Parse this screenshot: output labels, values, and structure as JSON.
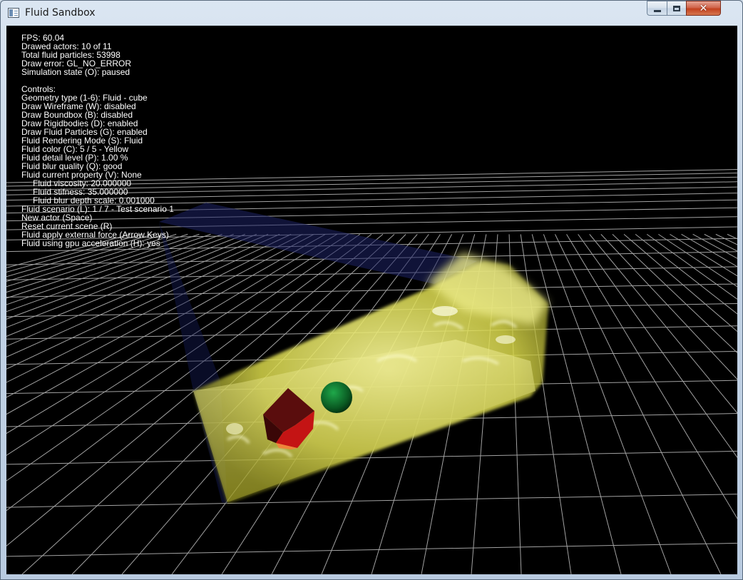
{
  "window": {
    "title": "Fluid Sandbox",
    "buttons": {
      "minimize": "minimize-icon",
      "maximize": "maximize-icon",
      "close": "close-icon"
    }
  },
  "hud": {
    "status": [
      "FPS: 60.04",
      "Drawed actors: 10 of 11",
      "Total fluid particles: 53998",
      "Draw error: GL_NO_ERROR",
      "Simulation state (O): paused"
    ],
    "controls_title": "Controls:",
    "controls": [
      "Geometry type (1-6): Fluid - cube",
      "Draw Wireframe (W): disabled",
      "Draw Boundbox (B): disabled",
      "Draw Rigidbodies (D): enabled",
      "Draw Fluid Particles (G): enabled",
      "Fluid Rendering Mode (S): Fluid",
      "Fluid color (C): 5 / 5 - Yellow",
      "Fluid detail level (P): 1.00 %",
      "Fluid blur quality (Q): good",
      "Fluid current property (V): None"
    ],
    "properties": [
      "Fluid viscosity: 20.000000",
      "Fluid stifness: 35.000000",
      "Fluid blur depth scale: 0.001000"
    ],
    "more_controls": [
      "Fluid scenario (L): 1 / 7 - Test scenario 1",
      "New actor (Space)",
      "Reset current scene (R)",
      "Fluid apply external force (Arrow Keys)",
      "Fluid using gpu acceleration (H): yes"
    ]
  },
  "colors": {
    "background": "#000000",
    "grid": "#bfbfbf",
    "fluid": "#e6e65a",
    "box": "#2a2f7a",
    "cube": "#c41414",
    "sphere": "#0b6b2a"
  }
}
